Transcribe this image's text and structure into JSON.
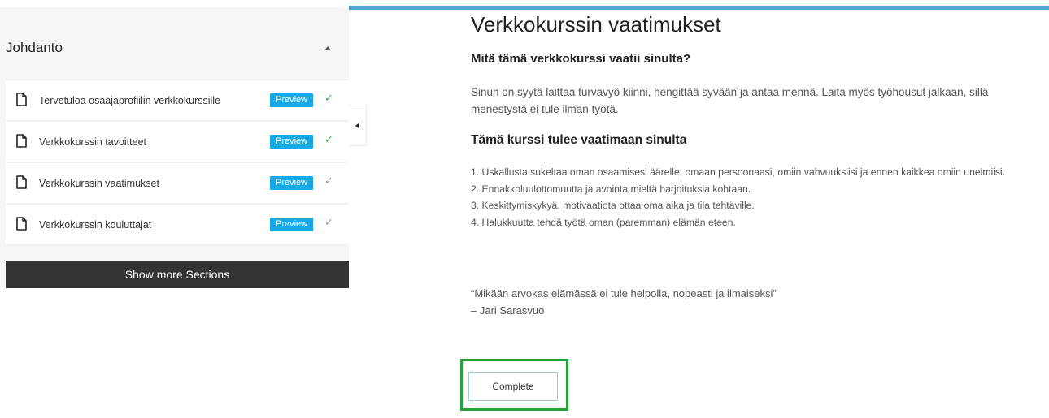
{
  "sidebar": {
    "section_title": "Johdanto",
    "lessons": [
      {
        "label": "Tervetuloa osaajaprofiilin verkkokurssille",
        "badge": "Preview",
        "status": "completed"
      },
      {
        "label": "Verkkokurssin tavoitteet",
        "badge": "Preview",
        "status": "completed"
      },
      {
        "label": "Verkkokurssin vaatimukset",
        "badge": "Preview",
        "status": "incomplete"
      },
      {
        "label": "Verkkokurssin kouluttajat",
        "badge": "Preview",
        "status": "incomplete"
      }
    ],
    "check_glyph": "✓",
    "show_more_label": "Show more Sections"
  },
  "content": {
    "title": "Verkkokurssin vaatimukset",
    "subheading1": "Mitä tämä verkkokurssi vaatii sinulta?",
    "paragraph_lines": [
      "Sinun on syytä laittaa turvavyö kiinni, hengittää syvään ja antaa mennä. Laita myös työhousut jalkaan, sillä",
      "menestystä ei tule ilman työtä."
    ],
    "subheading2": "Tämä kurssi tulee vaatimaan sinulta",
    "requirements": [
      "1. Uskallusta sukeltaa oman osaamisesi äärelle, omaan persoonaasi, omiin vahvuuksiisi ja ennen kaikkea omiin unelmiisi.",
      "2. Ennakkoluulottomuutta ja avointa mieltä harjoituksia kohtaan.",
      "3. Keskittymiskykyä, motivaatiota ottaa oma aika ja tila tehtäville.",
      "4. Halukkuutta tehdä työtä oman (paremman) elämän eteen."
    ],
    "quote": "“Mikään arvokas elämässä ei tule helpolla, nopeasti ja ilmaiseksi”",
    "quote_author": "– Jari Sarasvuo",
    "complete_label": "Complete"
  },
  "colors": {
    "accent_bar": "#4ea7cf",
    "preview_badge": "#17a9e6",
    "check_done": "#2bb24c",
    "check_pending": "#999999",
    "highlight": "#26a038",
    "show_more_bg": "#333333"
  },
  "icons": {
    "lesson": "document-icon",
    "collapse_section": "caret-up-icon",
    "sidebar_toggle": "caret-left-icon"
  }
}
